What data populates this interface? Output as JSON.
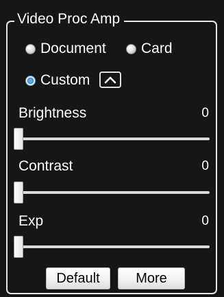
{
  "group_title": "Video Proc Amp",
  "modes": {
    "document": {
      "label": "Document",
      "checked": false
    },
    "card": {
      "label": "Card",
      "checked": false
    },
    "custom": {
      "label": "Custom",
      "checked": true
    }
  },
  "collapse_button_icon": "chevron-up-icon",
  "sliders": {
    "brightness": {
      "label": "Brightness",
      "value": "0",
      "position": 0
    },
    "contrast": {
      "label": "Contrast",
      "value": "0",
      "position": 0
    },
    "exp": {
      "label": "Exp",
      "value": "0",
      "position": 0
    }
  },
  "buttons": {
    "default_label": "Default",
    "more_label": "More"
  },
  "colors": {
    "panel_background": "#161616",
    "text": "#ffffff",
    "radio_selected": "#2a6fb5"
  }
}
